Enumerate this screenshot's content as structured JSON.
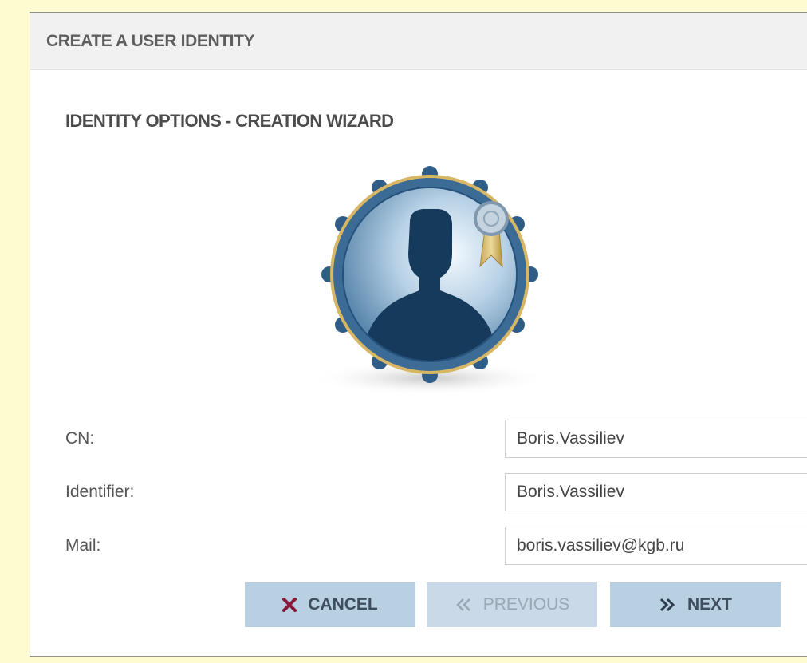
{
  "dialog": {
    "title": "CREATE A USER IDENTITY",
    "subtitle": "IDENTITY OPTIONS - CREATION WIZARD"
  },
  "fields": [
    {
      "label": "CN:",
      "value": "Boris.Vassiliev"
    },
    {
      "label": "Identifier:",
      "value": "Boris.Vassiliev"
    },
    {
      "label": "Mail:",
      "value": "boris.vassiliev@kgb.ru"
    }
  ],
  "buttons": {
    "cancel": "CANCEL",
    "previous": "PREVIOUS",
    "next": "NEXT"
  },
  "icons": {
    "avatar": "user-identity-badge-icon",
    "cancel": "close-icon",
    "previous": "double-chevron-left-icon",
    "next": "double-chevron-right-icon"
  },
  "colors": {
    "page_background": "#fefbd0",
    "button": "#b9cfe2",
    "button_disabled": "#c9d9e7",
    "cancel_icon": "#8b1a3a"
  }
}
